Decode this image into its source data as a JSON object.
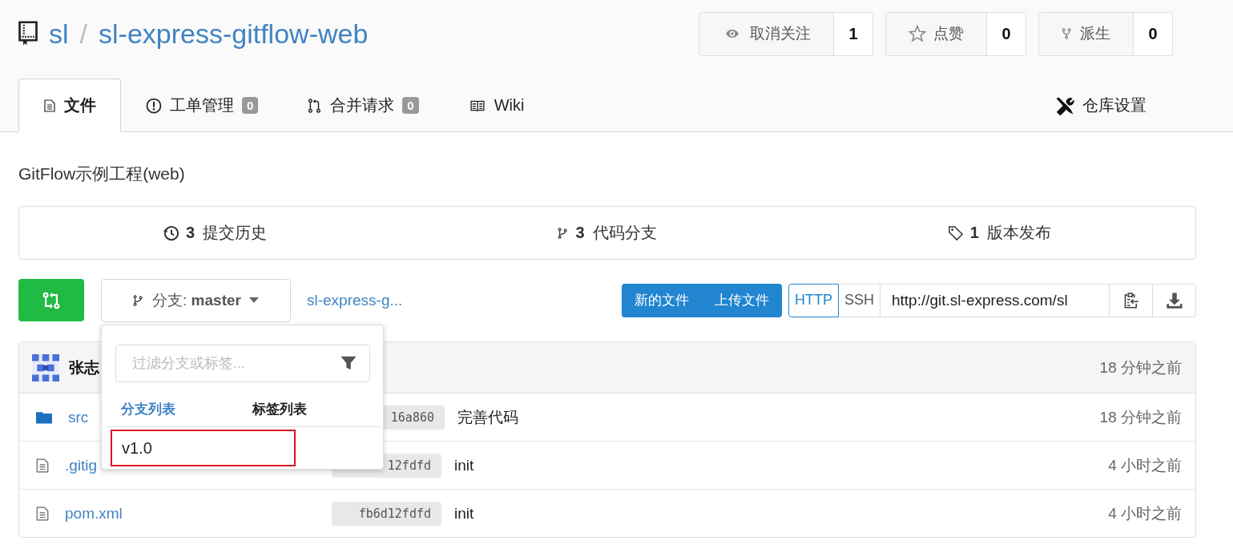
{
  "repo": {
    "owner": "sl",
    "separator": "/",
    "name": "sl-express-gitflow-web"
  },
  "actions": [
    {
      "kind": "watch",
      "label": "取消关注",
      "count": "1"
    },
    {
      "kind": "star",
      "label": "点赞",
      "count": "0"
    },
    {
      "kind": "fork",
      "label": "派生",
      "count": "0"
    }
  ],
  "tabs": [
    {
      "kind": "files",
      "label": "文件",
      "selected": true
    },
    {
      "kind": "issues",
      "label": "工单管理",
      "badge": "0",
      "selected": false
    },
    {
      "kind": "pulls",
      "label": "合并请求",
      "badge": "0",
      "selected": false
    },
    {
      "kind": "wiki",
      "label": "Wiki",
      "selected": false
    }
  ],
  "settings_tab": {
    "label": "仓库设置"
  },
  "description": "GitFlow示例工程(web)",
  "stats": [
    {
      "kind": "commits",
      "count": "3",
      "label": "提交历史"
    },
    {
      "kind": "branches",
      "count": "3",
      "label": "代码分支"
    },
    {
      "kind": "releases",
      "count": "1",
      "label": "版本发布"
    }
  ],
  "branch_selector": {
    "label": "分支:",
    "branch": "master"
  },
  "repo_path": "sl-express-g...",
  "buttons": [
    "新的文件",
    "上传文件"
  ],
  "clone": {
    "protocols": [
      {
        "label": "HTTP",
        "selected": true
      },
      {
        "label": "SSH",
        "selected": false
      }
    ],
    "url": "http://git.sl-express.com/sl"
  },
  "dropdown": {
    "placeholder": "过滤分支或标签...",
    "tabs": [
      {
        "label": "分支列表",
        "selected": true
      },
      {
        "label": "标签列表",
        "selected": false
      }
    ],
    "items": [
      {
        "label": "v1.0",
        "highlighted": true
      }
    ]
  },
  "last_commit": {
    "author": "张志",
    "time": "18 分钟之前"
  },
  "files": [
    {
      "kind": "folder",
      "name": "src",
      "sha": "16a860",
      "message": "完善代码",
      "time": "18 分钟之前"
    },
    {
      "kind": "file",
      "name": ".gitig",
      "sha": "12fdfd",
      "message": "init",
      "time": "4 小时之前"
    },
    {
      "kind": "file",
      "name": "pom.xml",
      "sha": "fb6d12fdfd",
      "message": "init",
      "time": "4 小时之前"
    }
  ]
}
